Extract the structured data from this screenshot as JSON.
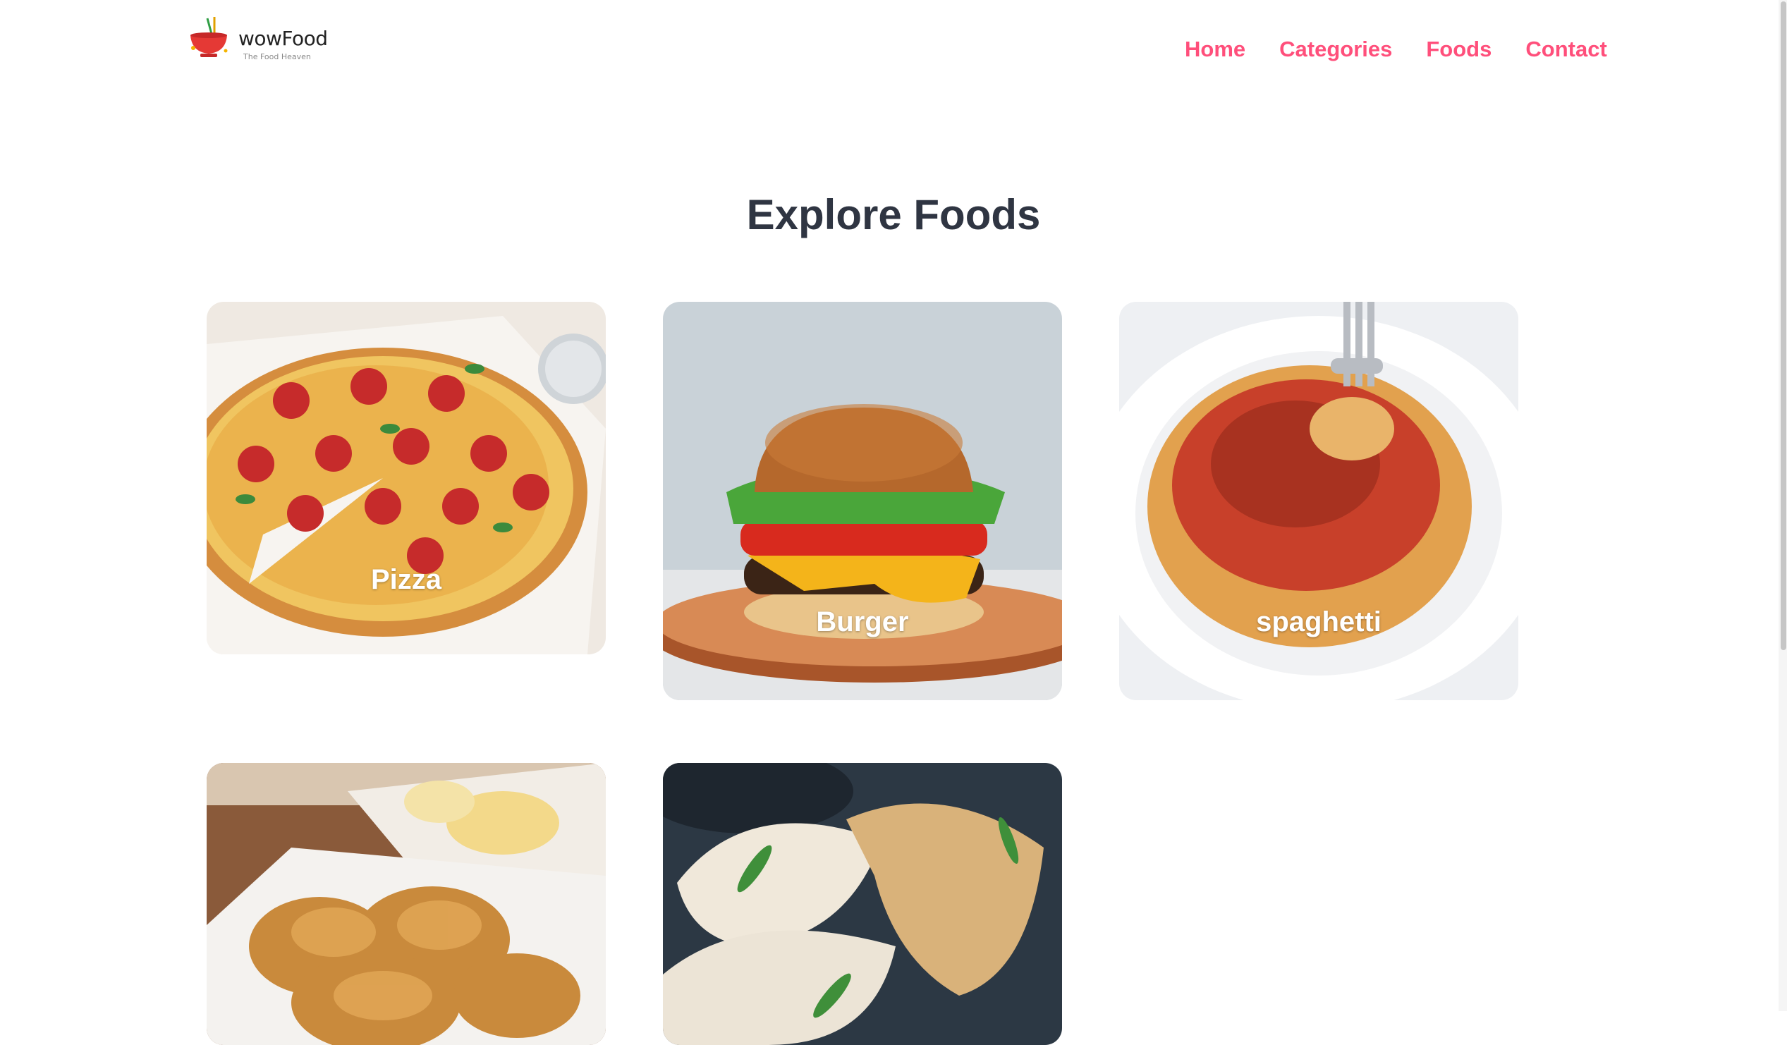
{
  "brand": {
    "name": "wowFood",
    "tagline": "The Food Heaven",
    "accent_color": "#ff4f7b"
  },
  "nav": {
    "items": [
      {
        "label": "Home"
      },
      {
        "label": "Categories"
      },
      {
        "label": "Foods"
      },
      {
        "label": "Contact"
      }
    ]
  },
  "main": {
    "title": "Explore Foods",
    "categories": [
      {
        "label": "Pizza",
        "image_icon": "pizza-image"
      },
      {
        "label": "Burger",
        "image_icon": "burger-image"
      },
      {
        "label": "spaghetti",
        "image_icon": "spaghetti-image"
      },
      {
        "label": "",
        "image_icon": "fried-chicken-image"
      },
      {
        "label": "",
        "image_icon": "dumplings-image"
      }
    ]
  }
}
